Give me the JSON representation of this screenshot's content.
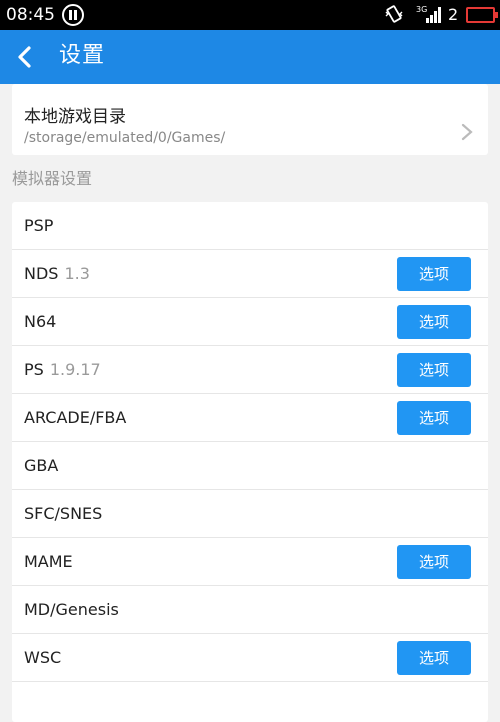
{
  "status_bar": {
    "time": "08:45",
    "network_type": "3G",
    "sim_count": "2",
    "battery_color": "#e53935"
  },
  "app_bar": {
    "title": "设置",
    "back_icon": "back-arrow-icon",
    "background": "#1e88e5"
  },
  "game_dir": {
    "title": "本地游戏目录",
    "path": "/storage/emulated/0/Games/"
  },
  "emulator_section": {
    "header": "模拟器设置",
    "button_color": "#2196f3",
    "items": [
      {
        "name": "PSP",
        "version": "",
        "options_label": ""
      },
      {
        "name": "NDS",
        "version": "1.3",
        "options_label": "选项"
      },
      {
        "name": "N64",
        "version": "",
        "options_label": "选项"
      },
      {
        "name": "PS",
        "version": "1.9.17",
        "options_label": "选项"
      },
      {
        "name": "ARCADE/FBA",
        "version": "",
        "options_label": "选项"
      },
      {
        "name": "GBA",
        "version": "",
        "options_label": ""
      },
      {
        "name": "SFC/SNES",
        "version": "",
        "options_label": ""
      },
      {
        "name": "MAME",
        "version": "",
        "options_label": "选项"
      },
      {
        "name": "MD/Genesis",
        "version": "",
        "options_label": ""
      },
      {
        "name": "WSC",
        "version": "",
        "options_label": "选项"
      }
    ]
  }
}
